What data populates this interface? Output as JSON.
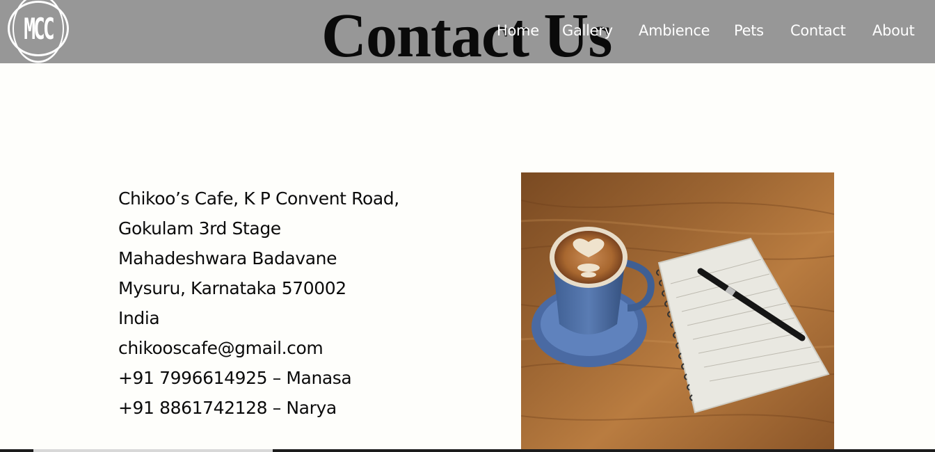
{
  "header": {
    "logo_text": "MCC",
    "title": "Contact Us",
    "nav": [
      {
        "label": "Home"
      },
      {
        "label": "Gallery"
      },
      {
        "label": "Ambience"
      },
      {
        "label": "Pets"
      },
      {
        "label": "Contact"
      },
      {
        "label": "About"
      }
    ]
  },
  "contact": {
    "lines": [
      "Chikoo’s Cafe, K P Convent Road,",
      "Gokulam 3rd Stage",
      "Mahadeshwara Badavane",
      "Mysuru, Karnataka 570002",
      "India",
      "chikooscafe@gmail.com",
      "+91 7996614925 – Manasa",
      "+91 8861742128 – Narya"
    ]
  },
  "colors": {
    "header_bg": "#979797",
    "page_bg": "#fefefb",
    "nav_text": "#ffffff",
    "body_text": "#0b0b0b"
  }
}
